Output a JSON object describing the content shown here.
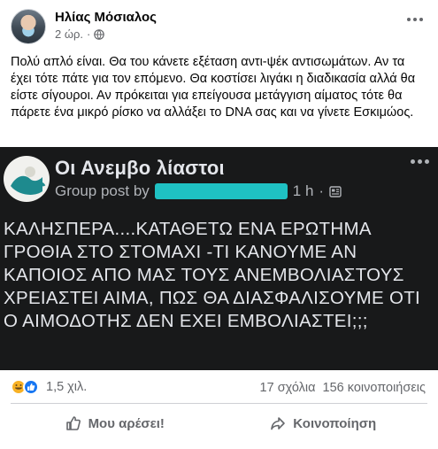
{
  "post": {
    "author": "Ηλίας Μόσιαλος",
    "time": "2 ώρ.",
    "separator": "·",
    "body": "Πολύ απλό είναι. Θα του κάνετε εξέταση αντι-ψέκ αντισωμάτων. Αν τα έχει τότε πάτε για τον επόμενο. Θα κοστίσει λιγάκι η διαδικασία αλλά θα είστε σίγουροι. Αν πρόκειται για επείγουσα μετάγγιση αίματος τότε θα πάρετε ένα μικρό ρίσκο να αλλάξει το DNA σας και να γίνετε Εσκιμώος."
  },
  "shared": {
    "group_name": "Οι Ανεμβο λίαστοι",
    "group_post_by": "Group post by",
    "time": "1 h",
    "separator": "·",
    "text": "ΚΑΛΗΣΠΕΡΑ....ΚΑΤΑΘΕΤΩ ΕΝΑ ΕΡΩΤΗΜΑ ΓΡΟΘΙΑ ΣΤΟ ΣΤΟΜΑΧΙ -ΤΙ ΚΑΝΟΥΜΕ ΑΝ ΚΑΠΟΙΟΣ ΑΠΟ ΜΑΣ ΤΟΥΣ ΑΝΕΜΒΟΛΙΑΣΤΟΥΣ ΧΡΕΙΑΣΤΕΙ ΑΙΜΑ, ΠΩΣ ΘΑ ΔΙΑΣΦΑΛΙΣΟΥΜΕ ΟΤΙ Ο ΑΙΜΟΔΟΤΗΣ ΔΕΝ ΕΧΕΙ ΕΜΒΟΛΙΑΣΤΕΙ;;;",
    "redaction_color": "#1fc1c3"
  },
  "stats": {
    "reactions_count": "1,5 χιλ.",
    "comments": "17 σχόλια",
    "shares": "156 κοινοποιήσεις",
    "reaction_icons": [
      "haha-icon",
      "like-icon"
    ]
  },
  "actions": {
    "like_label": "Μου αρέσει!",
    "share_label": "Κοινοποίηση"
  },
  "colors": {
    "meta_gray": "#65676b",
    "like_blue": "#1877f2",
    "haha_yellow": "#f7b125",
    "dark_bg": "#18191a"
  }
}
